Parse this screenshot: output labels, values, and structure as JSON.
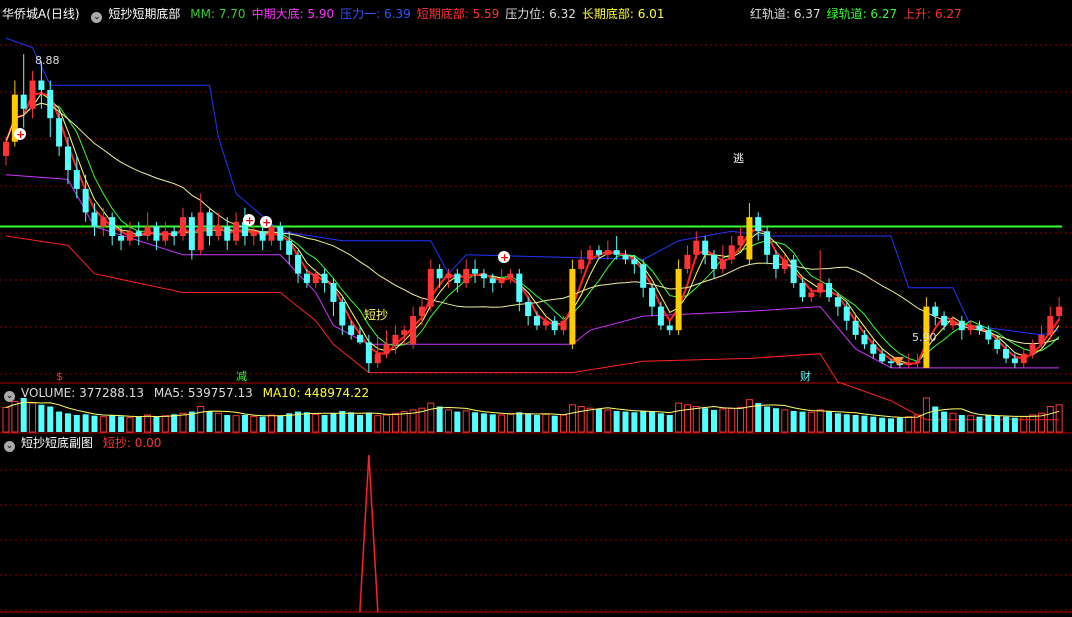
{
  "main_header": {
    "stock": "华侨城A",
    "period": "(日线)",
    "indicator": "短抄短期底部",
    "items": [
      {
        "label": "MM: 7.70",
        "color": "#33cc33"
      },
      {
        "label": "中期大底: 5.90",
        "color": "#ff33ff"
      },
      {
        "label": "压力一: 6.39",
        "color": "#3355ff"
      },
      {
        "label": "短期底部: 5.59",
        "color": "#ff3333"
      },
      {
        "label": "压力位: 6.32",
        "color": "#dddddd"
      },
      {
        "label": "长期底部: 6.01",
        "color": "#ffff33"
      }
    ],
    "right_items": [
      {
        "label": "红轨道: 6.37",
        "color": "#dddddd"
      },
      {
        "label": "绿轨道: 6.27",
        "color": "#33ff33"
      },
      {
        "label": "上升: 6.27",
        "color": "#ff3333"
      }
    ]
  },
  "volume_header": {
    "volume": "VOLUME: 377288.13",
    "ma5": "MA5: 539757.13",
    "ma10": "MA10: 448974.22"
  },
  "sub_header": {
    "title": "短抄短底副图",
    "value": "短抄: 0.00"
  },
  "annotations": {
    "high": "8.88",
    "low": "5.90",
    "duanchao": "短抄",
    "tao": "逃",
    "jian": "减",
    "cai": "财",
    "s": "$"
  },
  "colors": {
    "up": "#ff3333",
    "down": "#54ffff",
    "bg": "#000000",
    "grid": "#8b0000"
  },
  "chart_data": {
    "type": "candlestick",
    "price_range": [
      5.4,
      9.2
    ],
    "candles": [
      [
        7.8,
        7.95,
        7.7,
        8.0
      ],
      [
        7.95,
        8.45,
        7.9,
        8.6
      ],
      [
        8.45,
        8.3,
        8.1,
        8.88
      ],
      [
        8.3,
        8.6,
        8.2,
        8.7
      ],
      [
        8.6,
        8.5,
        8.3,
        8.8
      ],
      [
        8.5,
        8.2,
        8.0,
        8.6
      ],
      [
        8.2,
        7.9,
        7.8,
        8.3
      ],
      [
        7.9,
        7.65,
        7.5,
        8.0
      ],
      [
        7.65,
        7.45,
        7.35,
        7.8
      ],
      [
        7.45,
        7.2,
        7.1,
        7.6
      ],
      [
        7.2,
        7.05,
        6.95,
        7.3
      ],
      [
        7.05,
        7.15,
        6.95,
        7.25
      ],
      [
        7.15,
        6.95,
        6.85,
        7.2
      ],
      [
        6.95,
        6.9,
        6.8,
        7.05
      ],
      [
        6.9,
        7.0,
        6.85,
        7.1
      ],
      [
        7.0,
        6.95,
        6.85,
        7.1
      ],
      [
        6.95,
        7.05,
        6.9,
        7.2
      ],
      [
        7.05,
        6.9,
        6.8,
        7.1
      ],
      [
        6.9,
        7.0,
        6.85,
        7.1
      ],
      [
        7.0,
        6.95,
        6.85,
        7.05
      ],
      [
        6.95,
        7.15,
        6.9,
        7.25
      ],
      [
        7.15,
        6.8,
        6.7,
        7.2
      ],
      [
        6.8,
        7.2,
        6.75,
        7.4
      ],
      [
        7.2,
        6.95,
        6.85,
        7.25
      ],
      [
        6.95,
        7.05,
        6.9,
        7.2
      ],
      [
        7.05,
        6.9,
        6.8,
        7.15
      ],
      [
        6.9,
        7.1,
        6.85,
        7.2
      ],
      [
        7.1,
        6.95,
        6.85,
        7.25
      ],
      [
        6.95,
        7.0,
        6.85,
        7.1
      ],
      [
        7.0,
        6.9,
        6.8,
        7.05
      ],
      [
        6.9,
        7.05,
        6.85,
        7.1
      ],
      [
        7.05,
        6.9,
        6.8,
        7.1
      ],
      [
        6.9,
        6.75,
        6.65,
        7.0
      ],
      [
        6.75,
        6.55,
        6.45,
        6.8
      ],
      [
        6.55,
        6.45,
        6.4,
        6.6
      ],
      [
        6.45,
        6.55,
        6.4,
        6.6
      ],
      [
        6.55,
        6.45,
        6.35,
        6.6
      ],
      [
        6.45,
        6.25,
        6.1,
        6.5
      ],
      [
        6.25,
        6.0,
        5.9,
        6.3
      ],
      [
        6.0,
        5.9,
        5.85,
        6.05
      ],
      [
        5.9,
        5.82,
        5.8,
        6.0
      ],
      [
        5.82,
        5.6,
        5.5,
        5.9
      ],
      [
        5.6,
        5.7,
        5.55,
        5.9
      ],
      [
        5.7,
        5.8,
        5.65,
        5.95
      ],
      [
        5.8,
        5.9,
        5.7,
        6.0
      ],
      [
        5.9,
        5.95,
        5.8,
        6.0
      ],
      [
        5.8,
        6.1,
        5.75,
        6.2
      ],
      [
        6.1,
        6.2,
        6.0,
        6.3
      ],
      [
        6.2,
        6.6,
        6.15,
        6.7
      ],
      [
        6.6,
        6.5,
        6.4,
        6.65
      ],
      [
        6.5,
        6.55,
        6.4,
        6.6
      ],
      [
        6.55,
        6.45,
        6.35,
        6.6
      ],
      [
        6.45,
        6.6,
        6.4,
        6.7
      ],
      [
        6.6,
        6.55,
        6.45,
        6.7
      ],
      [
        6.55,
        6.5,
        6.4,
        6.6
      ],
      [
        6.5,
        6.45,
        6.35,
        6.55
      ],
      [
        6.45,
        6.5,
        6.4,
        6.6
      ],
      [
        6.5,
        6.55,
        6.45,
        6.6
      ],
      [
        6.55,
        6.25,
        6.15,
        6.6
      ],
      [
        6.25,
        6.1,
        6.0,
        6.3
      ],
      [
        6.1,
        6.0,
        5.95,
        6.15
      ],
      [
        6.0,
        6.05,
        5.95,
        6.1
      ],
      [
        6.05,
        5.95,
        5.9,
        6.1
      ],
      [
        5.95,
        6.05,
        5.9,
        6.1
      ],
      [
        5.8,
        6.6,
        5.75,
        6.7
      ],
      [
        6.6,
        6.7,
        6.55,
        6.8
      ],
      [
        6.7,
        6.8,
        6.65,
        6.85
      ],
      [
        6.8,
        6.75,
        6.7,
        6.85
      ],
      [
        6.75,
        6.8,
        6.7,
        6.9
      ],
      [
        6.8,
        6.75,
        6.7,
        6.95
      ],
      [
        6.75,
        6.7,
        6.65,
        6.8
      ],
      [
        6.7,
        6.65,
        6.55,
        6.75
      ],
      [
        6.65,
        6.4,
        6.3,
        6.7
      ],
      [
        6.4,
        6.2,
        6.1,
        6.45
      ],
      [
        6.2,
        6.0,
        5.95,
        6.25
      ],
      [
        6.0,
        5.95,
        5.9,
        6.05
      ],
      [
        5.95,
        6.6,
        5.9,
        6.7
      ],
      [
        6.6,
        6.75,
        6.55,
        6.85
      ],
      [
        6.75,
        6.9,
        6.7,
        7.0
      ],
      [
        6.9,
        6.75,
        6.65,
        6.95
      ],
      [
        6.75,
        6.6,
        6.5,
        6.8
      ],
      [
        6.6,
        6.7,
        6.55,
        6.85
      ],
      [
        6.7,
        6.85,
        6.65,
        6.95
      ],
      [
        6.85,
        6.95,
        6.8,
        7.05
      ],
      [
        6.7,
        7.15,
        6.65,
        7.3
      ],
      [
        7.15,
        7.0,
        6.9,
        7.2
      ],
      [
        7.0,
        6.75,
        6.65,
        7.05
      ],
      [
        6.75,
        6.6,
        6.5,
        6.8
      ],
      [
        6.6,
        6.7,
        6.55,
        6.75
      ],
      [
        6.7,
        6.45,
        6.4,
        6.75
      ],
      [
        6.45,
        6.3,
        6.25,
        6.5
      ],
      [
        6.3,
        6.35,
        6.25,
        6.4
      ],
      [
        6.35,
        6.45,
        6.3,
        6.8
      ],
      [
        6.45,
        6.3,
        6.25,
        6.5
      ],
      [
        6.3,
        6.2,
        6.1,
        6.35
      ],
      [
        6.2,
        6.05,
        5.95,
        6.25
      ],
      [
        6.05,
        5.9,
        5.85,
        6.1
      ],
      [
        5.9,
        5.8,
        5.75,
        5.95
      ],
      [
        5.8,
        5.7,
        5.65,
        5.85
      ],
      [
        5.7,
        5.62,
        5.6,
        5.75
      ],
      [
        5.62,
        5.6,
        5.55,
        5.65
      ],
      [
        5.6,
        5.58,
        5.55,
        5.65
      ],
      [
        5.58,
        5.6,
        5.55,
        5.7
      ],
      [
        5.6,
        5.62,
        5.55,
        5.7
      ],
      [
        5.55,
        6.2,
        5.55,
        6.3
      ],
      [
        6.2,
        6.1,
        6.0,
        6.25
      ],
      [
        6.1,
        6.0,
        5.95,
        6.15
      ],
      [
        6.0,
        6.05,
        5.95,
        6.1
      ],
      [
        6.05,
        5.95,
        5.85,
        6.1
      ],
      [
        5.95,
        6.0,
        5.9,
        6.05
      ],
      [
        6.0,
        5.95,
        5.9,
        6.05
      ],
      [
        5.95,
        5.85,
        5.8,
        6.0
      ],
      [
        5.85,
        5.75,
        5.7,
        5.9
      ],
      [
        5.75,
        5.65,
        5.6,
        5.8
      ],
      [
        5.65,
        5.6,
        5.55,
        5.7
      ],
      [
        5.6,
        5.7,
        5.55,
        5.75
      ],
      [
        5.7,
        5.8,
        5.65,
        5.85
      ],
      [
        5.8,
        5.9,
        5.75,
        6.0
      ],
      [
        5.9,
        6.1,
        5.85,
        6.2
      ],
      [
        6.1,
        6.2,
        6.05,
        6.3
      ]
    ],
    "volumes": [
      0.72,
      0.9,
      1.0,
      0.85,
      0.8,
      0.75,
      0.6,
      0.55,
      0.5,
      0.52,
      0.48,
      0.45,
      0.5,
      0.46,
      0.42,
      0.44,
      0.5,
      0.45,
      0.48,
      0.52,
      0.55,
      0.6,
      0.75,
      0.62,
      0.55,
      0.5,
      0.48,
      0.5,
      0.46,
      0.45,
      0.5,
      0.48,
      0.55,
      0.6,
      0.58,
      0.52,
      0.5,
      0.55,
      0.62,
      0.58,
      0.5,
      0.55,
      0.48,
      0.5,
      0.55,
      0.6,
      0.65,
      0.7,
      0.85,
      0.75,
      0.65,
      0.6,
      0.62,
      0.58,
      0.55,
      0.52,
      0.5,
      0.52,
      0.58,
      0.55,
      0.5,
      0.52,
      0.48,
      0.5,
      0.8,
      0.75,
      0.7,
      0.68,
      0.65,
      0.62,
      0.6,
      0.58,
      0.62,
      0.6,
      0.55,
      0.5,
      0.85,
      0.8,
      0.75,
      0.7,
      0.65,
      0.68,
      0.7,
      0.72,
      0.95,
      0.85,
      0.75,
      0.7,
      0.65,
      0.62,
      0.6,
      0.58,
      0.65,
      0.6,
      0.55,
      0.52,
      0.5,
      0.48,
      0.45,
      0.42,
      0.4,
      0.42,
      0.45,
      0.5,
      1.0,
      0.75,
      0.6,
      0.55,
      0.5,
      0.48,
      0.45,
      0.5,
      0.48,
      0.45,
      0.42,
      0.45,
      0.5,
      0.55,
      0.75,
      0.8
    ],
    "red_line": [
      [
        0,
        6.95
      ],
      [
        7,
        6.85
      ],
      [
        10,
        6.55
      ],
      [
        20,
        6.35
      ],
      [
        31,
        6.35
      ],
      [
        35,
        6.05
      ],
      [
        37,
        5.8
      ],
      [
        41,
        5.5
      ],
      [
        64,
        5.5
      ],
      [
        72,
        5.62
      ],
      [
        84,
        5.65
      ],
      [
        92,
        5.7
      ],
      [
        94,
        5.4
      ],
      [
        100,
        5.2
      ],
      [
        104,
        5.0
      ],
      [
        119,
        5.0
      ]
    ],
    "magenta_line": [
      [
        0,
        7.6
      ],
      [
        7,
        7.55
      ],
      [
        10,
        7.05
      ],
      [
        20,
        6.75
      ],
      [
        31,
        6.75
      ],
      [
        35,
        6.35
      ],
      [
        37,
        6.0
      ],
      [
        41,
        5.8
      ],
      [
        64,
        5.8
      ],
      [
        66,
        5.95
      ],
      [
        72,
        6.1
      ],
      [
        84,
        6.15
      ],
      [
        92,
        6.2
      ],
      [
        96,
        5.75
      ],
      [
        100,
        5.55
      ],
      [
        119,
        5.55
      ]
    ],
    "blue_line": [
      [
        0,
        9.05
      ],
      [
        3,
        8.95
      ],
      [
        5,
        8.55
      ],
      [
        23,
        8.55
      ],
      [
        24,
        8.0
      ],
      [
        26,
        7.4
      ],
      [
        31,
        7.0
      ],
      [
        38,
        6.9
      ],
      [
        48,
        6.9
      ],
      [
        50,
        6.55
      ],
      [
        52,
        6.75
      ],
      [
        72,
        6.7
      ],
      [
        76,
        6.9
      ],
      [
        82,
        7.0
      ],
      [
        86,
        6.95
      ],
      [
        100,
        6.95
      ],
      [
        102,
        6.4
      ],
      [
        107,
        6.4
      ],
      [
        109,
        6.0
      ],
      [
        117,
        5.9
      ],
      [
        119,
        5.95
      ]
    ],
    "green_hline": 7.05,
    "sub_spike": {
      "index": 41,
      "value": 1.0
    }
  }
}
